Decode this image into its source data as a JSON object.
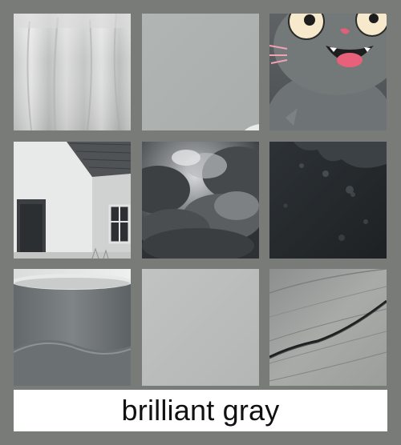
{
  "caption": {
    "label": "brilliant gray"
  },
  "colors": {
    "page_background": "#787b77",
    "caption_background": "#ffffff",
    "caption_text": "#111111"
  },
  "tiles": [
    {
      "subject": "draped-fabric"
    },
    {
      "subject": "flat-gray-swatch"
    },
    {
      "subject": "cartoon-cat"
    },
    {
      "subject": "white-house"
    },
    {
      "subject": "storm-clouds"
    },
    {
      "subject": "dark-textured-surface"
    },
    {
      "subject": "gray-mug"
    },
    {
      "subject": "light-gray-swatch"
    },
    {
      "subject": "weathered-wood"
    }
  ]
}
